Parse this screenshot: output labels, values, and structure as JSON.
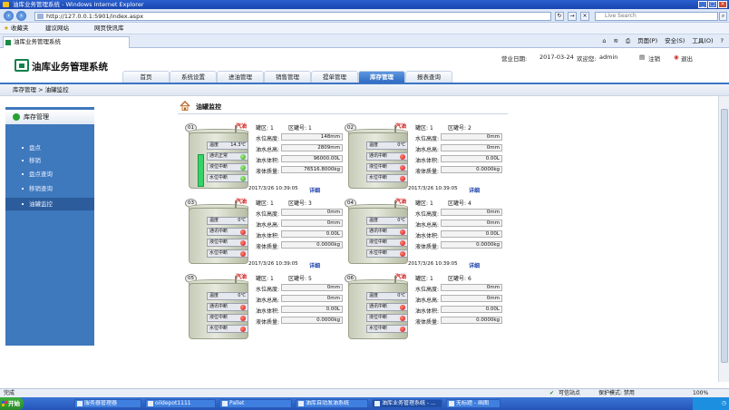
{
  "window": {
    "title": "油库业务管理系统 - Windows Internet Explorer"
  },
  "browser": {
    "url": "http://127.0.0.1:5901/index.aspx",
    "search_placeholder": "Live Search",
    "favorites": {
      "label": "收藏夹",
      "suggested": "建议网站",
      "web_slice": "网页快讯库"
    },
    "tab_title": "油库业务管理系统",
    "commands": [
      "页面(P)",
      "安全(S)",
      "工具(O)"
    ]
  },
  "app": {
    "title": "油库业务管理系统",
    "business_date_label": "营业日期:",
    "business_date": "2017-03-24",
    "welcome_label": "欢迎您:",
    "user": "admin",
    "logout_note": "注销",
    "exit": "退出",
    "nav": [
      "首页",
      "系统设置",
      "进油管理",
      "销售管理",
      "提单管理",
      "库存管理",
      "报表查询"
    ],
    "active_nav": "库存管理"
  },
  "breadcrumb": "库存管理 > 油罐监控",
  "sidebar": {
    "header": "库存管理",
    "items": [
      "盘点",
      "移销",
      "盘点查询",
      "移销查询",
      "油罐监控"
    ],
    "active": "油罐监控"
  },
  "content": {
    "title": "油罐监控",
    "labels": {
      "zone": "罐区:",
      "area": "区罐号:",
      "water_level": "水位高度:",
      "oil_height": "油水总高:",
      "oil_volume": "油水体积:",
      "mass": "液体质量:",
      "temp": "温度",
      "detail": "详细"
    },
    "tanks": [
      {
        "num": "01",
        "fuel": "汽油",
        "zone": "1",
        "area": "1",
        "water": "148mm",
        "total": "2809mm",
        "volume": "96000.00L",
        "mass": "76516.8000kg",
        "temp": "14.3℃",
        "time": "2017/3/26 10:39:05",
        "status": [
          "通讯正常",
          "液位中断",
          "水位中断"
        ],
        "dots": [
          "green",
          "green",
          "green"
        ],
        "level": 0.45
      },
      {
        "num": "02",
        "fuel": "汽油",
        "zone": "1",
        "area": "2",
        "water": "0mm",
        "total": "0mm",
        "volume": "0.00L",
        "mass": "0.0000kg",
        "temp": "0℃",
        "time": "2017/3/26 10:39:05",
        "status": [
          "通讯中断",
          "液位中断",
          "水位中断"
        ],
        "dots": [
          "red",
          "red",
          "red"
        ],
        "level": 0
      },
      {
        "num": "03",
        "fuel": "汽油",
        "zone": "1",
        "area": "3",
        "water": "0mm",
        "total": "0mm",
        "volume": "0.00L",
        "mass": "0.0000kg",
        "temp": "0℃",
        "time": "2017/3/26 10:39:05",
        "status": [
          "通讯中断",
          "液位中断",
          "水位中断"
        ],
        "dots": [
          "red",
          "red",
          "red"
        ],
        "level": 0
      },
      {
        "num": "04",
        "fuel": "汽油",
        "zone": "1",
        "area": "4",
        "water": "0mm",
        "total": "0mm",
        "volume": "0.00L",
        "mass": "0.0000kg",
        "temp": "0℃",
        "time": "2017/3/26 10:39:05",
        "status": [
          "通讯中断",
          "液位中断",
          "水位中断"
        ],
        "dots": [
          "red",
          "red",
          "red"
        ],
        "level": 0
      },
      {
        "num": "05",
        "fuel": "汽油",
        "zone": "1",
        "area": "5",
        "water": "0mm",
        "total": "0mm",
        "volume": "0.00L",
        "mass": "0.0000kg",
        "temp": "0℃",
        "time": "",
        "status": [
          "通讯中断",
          "液位中断",
          "水位中断"
        ],
        "dots": [
          "red",
          "red",
          "red"
        ],
        "level": 0
      },
      {
        "num": "06",
        "fuel": "汽油",
        "zone": "1",
        "area": "6",
        "water": "0mm",
        "total": "0mm",
        "volume": "0.00L",
        "mass": "0.0000kg",
        "temp": "0℃",
        "time": "",
        "status": [
          "通讯中断",
          "液位中断",
          "水位中断"
        ],
        "dots": [
          "red",
          "red",
          "red"
        ],
        "level": 0
      }
    ]
  },
  "statusbar": {
    "left": "完成",
    "zone": "可信站点",
    "protected": "保护模式: 禁用",
    "zoom": "100%"
  },
  "taskbar": {
    "start": "开始",
    "tasks": [
      "服务器管理器",
      "oildepot1111",
      "Pallet",
      "油库自动发油系统",
      "油库业务管理系统 - ...",
      "无标题 - 画图"
    ],
    "active_task": "油库业务管理系统 - ..."
  },
  "colors": {
    "accent": "#3a74c6",
    "sidebar": "#3e78bd",
    "fuel_label": "#d01818",
    "ok": "#2ea021",
    "alarm": "#d01010"
  }
}
